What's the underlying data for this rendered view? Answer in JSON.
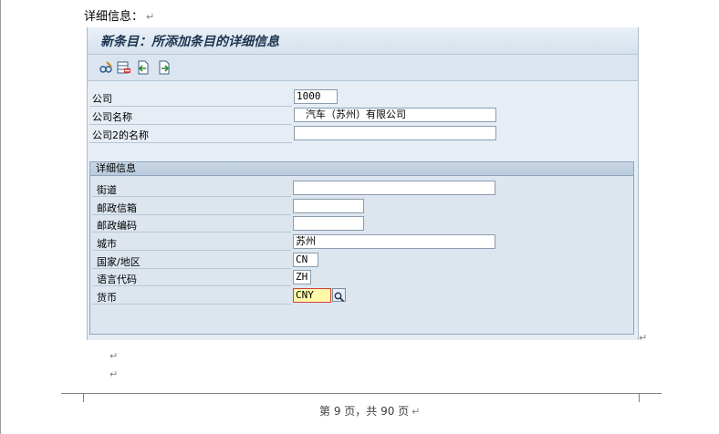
{
  "doc": {
    "heading": "详细信息：",
    "para_mark": "↵",
    "footer": "第 9 页，共 90 页"
  },
  "sap": {
    "title": "新条目：所添加条目的详细信息",
    "toolbar_icons": [
      "glasses-edit-icon",
      "delete-rows-icon",
      "prev-entry-icon",
      "next-entry-icon"
    ],
    "fields": {
      "company_label": "公司",
      "company_value": "1000",
      "company_name_label": "公司名称",
      "company_name_value": "汽车（苏州）有限公司",
      "company_name2_label": "公司2的名称",
      "company_name2_value": ""
    },
    "group": {
      "title": "详细信息",
      "street_label": "街道",
      "street_value": "",
      "pobox_label": "邮政信箱",
      "pobox_value": "",
      "postcode_label": "邮政编码",
      "postcode_value": "",
      "city_label": "城市",
      "city_value": "苏州",
      "country_label": "国家/地区",
      "country_value": "CN",
      "lang_label": "语言代码",
      "lang_value": "ZH",
      "currency_label": "货币",
      "currency_value": "CNY"
    }
  },
  "colors": {
    "panel_bg": "#dde6f0",
    "title_text": "#1d3550",
    "highlight": "#fff8a8"
  }
}
